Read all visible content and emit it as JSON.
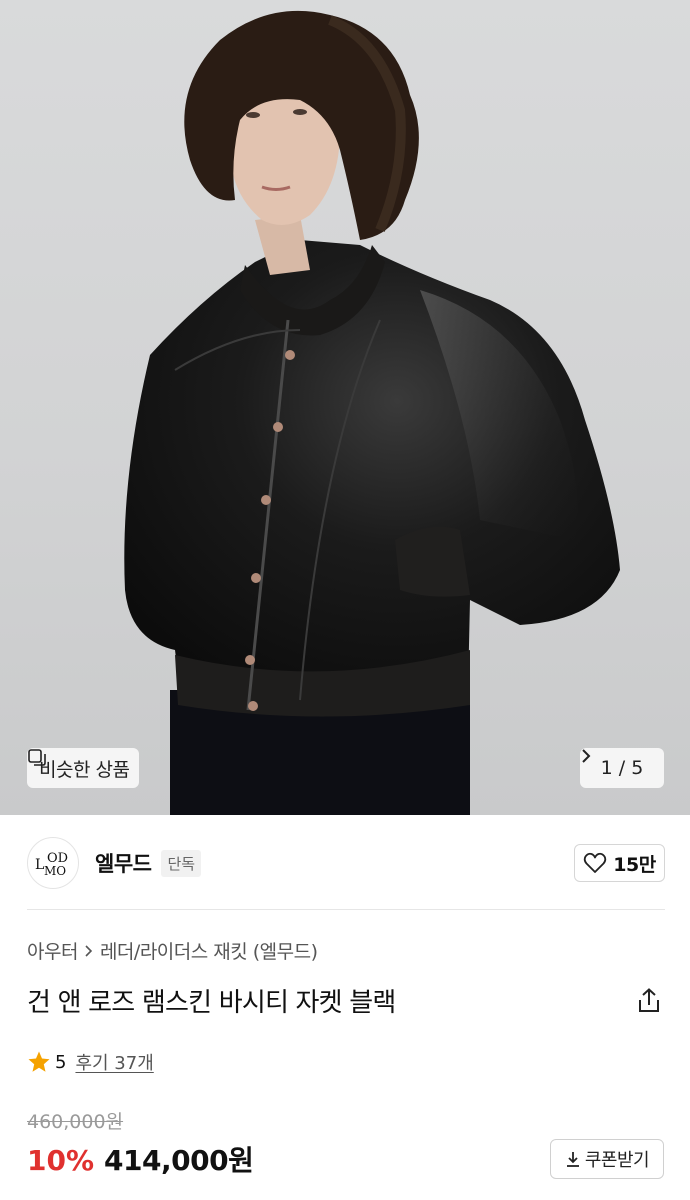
{
  "hero": {
    "similar_label": "비슷한 상품",
    "pager": "1 / 5",
    "icons": {
      "similar": "similar-items-icon",
      "next": "chevron-right-icon"
    }
  },
  "brand": {
    "logo_text_top": "OD",
    "logo_text_left": "L",
    "logo_text_bottom": "MO",
    "name": "엘무드",
    "badge": "단독",
    "likes": "15만"
  },
  "breadcrumb": {
    "category": "아우터",
    "subcategory": "레더/라이더스 재킷 (엘무드)"
  },
  "product": {
    "title": "건 앤 로즈 램스킨 바시티 자켓 블랙",
    "rating": "5",
    "reviews": "후기 37개"
  },
  "price": {
    "original": "460,000원",
    "discount": "10%",
    "final": "414,000원",
    "coupon_label": "쿠폰받기"
  },
  "colors": {
    "accent_red": "#e0312f",
    "star": "#f5a200"
  }
}
